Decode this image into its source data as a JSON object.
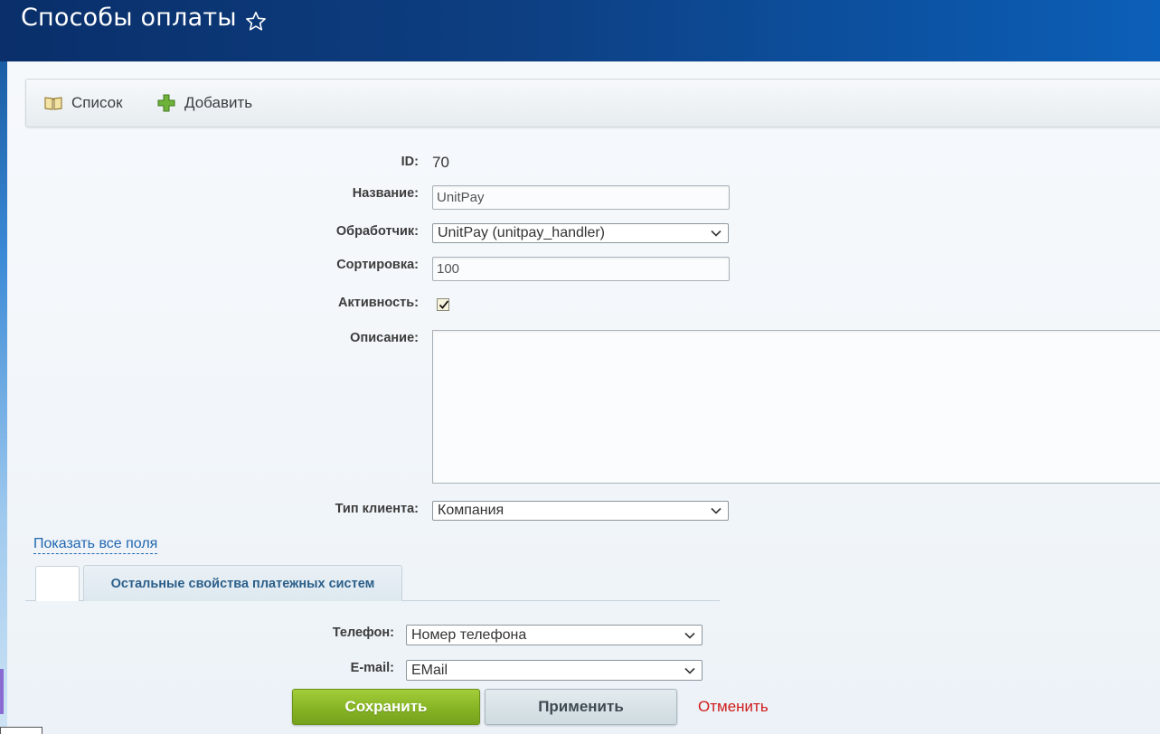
{
  "header": {
    "title": "Способы оплаты"
  },
  "toolbar": {
    "list_label": "Список",
    "add_label": "Добавить"
  },
  "form": {
    "id_label": "ID:",
    "id_value": "70",
    "name_label": "Название:",
    "name_value": "UnitPay",
    "handler_label": "Обработчик:",
    "handler_value": "UnitPay (unitpay_handler)",
    "sort_label": "Сортировка:",
    "sort_value": "100",
    "active_label": "Активность:",
    "active_checked": true,
    "description_label": "Описание:",
    "description_value": "",
    "client_type_label": "Тип клиента:",
    "client_type_value": "Компания"
  },
  "show_all_fields": "Показать все поля",
  "tabs": [
    {
      "label": "",
      "active": true
    },
    {
      "label": "Остальные свойства платежных систем",
      "active": false
    }
  ],
  "props": {
    "phone_label": "Телефон:",
    "phone_value": "Номер телефона",
    "email_label": "E-mail:",
    "email_value": "EMail"
  },
  "buttons": {
    "save": "Сохранить",
    "apply": "Применить",
    "cancel": "Отменить"
  },
  "colors": {
    "header_bg": "#0d3f82",
    "save_green": "#86b425",
    "cancel_red": "#cf1b1b",
    "link_blue": "#2067b0"
  },
  "icons": {
    "favorite": "star-outline-icon",
    "list": "book-icon",
    "add": "green-plus-icon",
    "dropdown": "chevron-down-icon"
  }
}
